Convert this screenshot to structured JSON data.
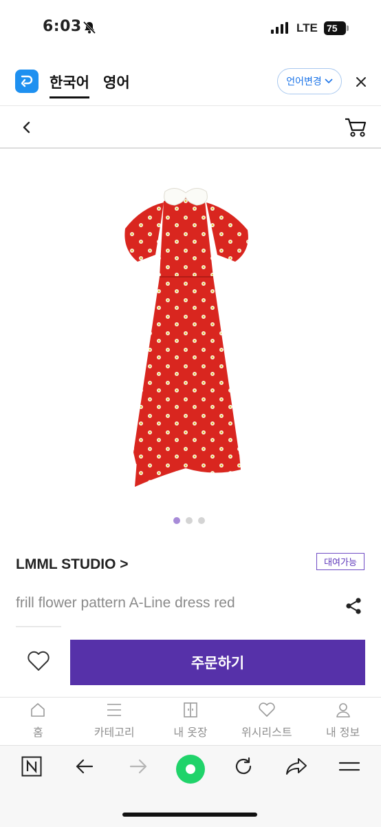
{
  "status_bar": {
    "time": "6:03",
    "network": "LTE",
    "battery": "75"
  },
  "translate_bar": {
    "tabs": [
      {
        "label": "한국어",
        "active": true
      },
      {
        "label": "영어",
        "active": false
      }
    ],
    "change_language_label": "언어변경",
    "accent_color": "#1a73e8"
  },
  "product": {
    "brand": "LMML STUDIO >",
    "badge": "대여가능",
    "name": "frill flower pattern A-Line dress red",
    "image_count": 3,
    "active_image": 1
  },
  "action_bar": {
    "order_label": "주문하기",
    "button_color": "#5631a9"
  },
  "tab_bar": {
    "items": [
      {
        "label": "홈",
        "icon": "home-icon"
      },
      {
        "label": "카테고리",
        "icon": "menu-icon"
      },
      {
        "label": "내 옷장",
        "icon": "closet-icon"
      },
      {
        "label": "위시리스트",
        "icon": "heart-icon"
      },
      {
        "label": "내 정보",
        "icon": "person-icon"
      }
    ]
  },
  "browser_bar": {
    "icons": [
      "naver-icon",
      "back-arrow-icon",
      "forward-arrow-icon",
      "green-dot-icon",
      "refresh-icon",
      "share-arrow-icon",
      "menu-lines-icon"
    ]
  }
}
